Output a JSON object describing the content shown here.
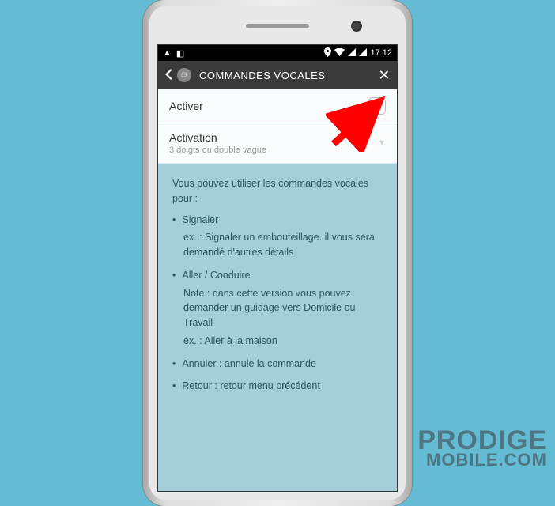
{
  "status_bar": {
    "time": "17:12",
    "left_icons": [
      "vlc-icon",
      "notification-icon"
    ],
    "right_icons": [
      "location-icon",
      "wifi-icon",
      "signal-icon",
      "signal-icon"
    ]
  },
  "header": {
    "title": "COMMANDES VOCALES"
  },
  "rows": {
    "activate": {
      "label": "Activer",
      "checked": false
    },
    "activation": {
      "label": "Activation",
      "subtitle": "3 doigts ou double vague"
    }
  },
  "info": {
    "intro": "Vous pouvez utiliser les commandes vocales pour :",
    "items": [
      {
        "title": "Signaler",
        "lines": [
          "ex. : Signaler un embouteillage. il vous sera demandé d'autres détails"
        ]
      },
      {
        "title": "Aller / Conduire",
        "lines": [
          "Note : dans cette version vous pouvez demander un guidage vers Domicile ou Travail",
          "ex. : Aller à la maison"
        ]
      },
      {
        "title": "Annuler : annule la commande",
        "lines": []
      },
      {
        "title": "Retour : retour menu précédent",
        "lines": []
      }
    ]
  },
  "watermark": {
    "line1": "PRODIGE",
    "line2": "MOBILE.COM"
  }
}
